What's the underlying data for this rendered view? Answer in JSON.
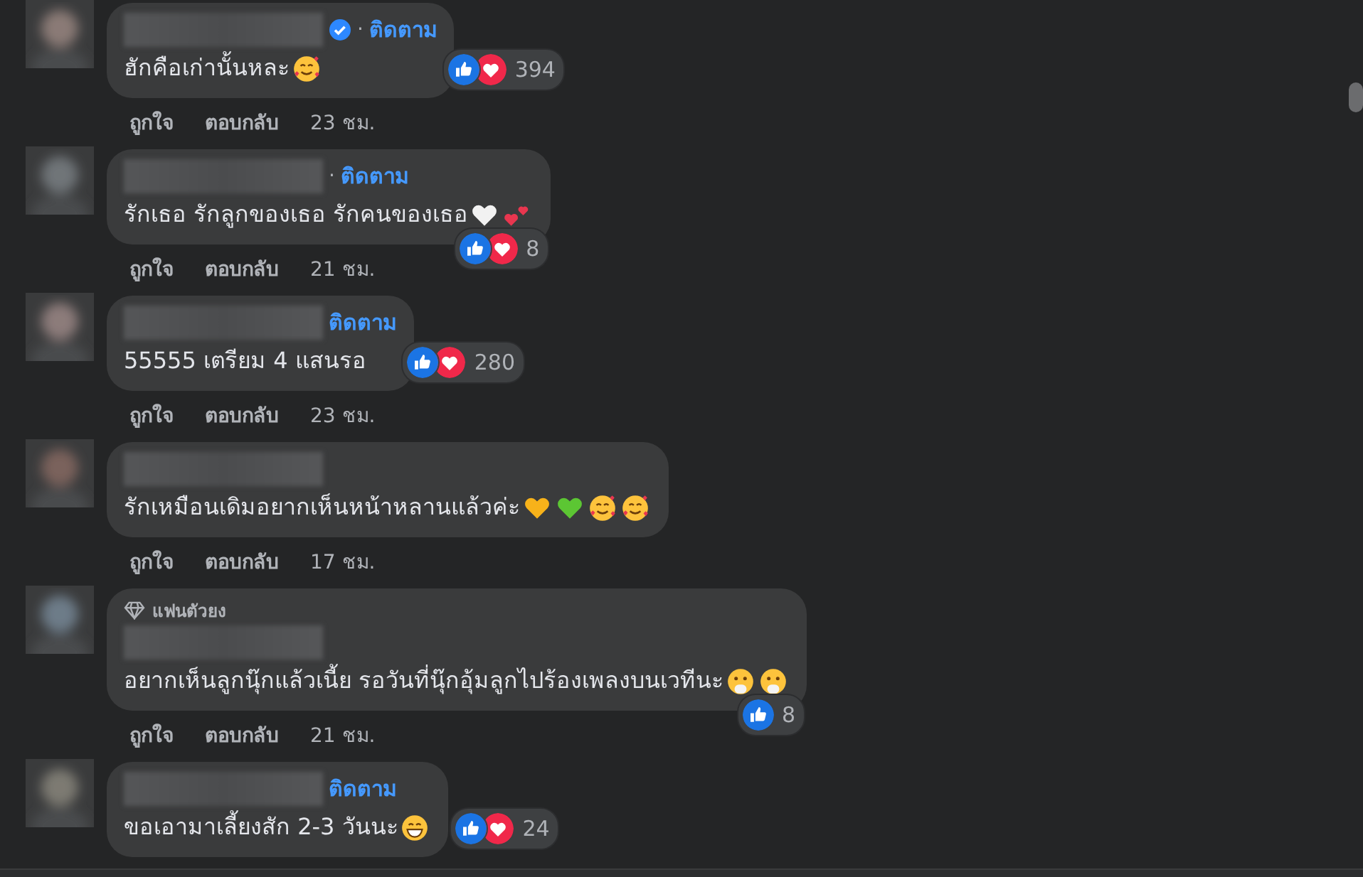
{
  "comments": [
    {
      "verified": true,
      "separator": "·",
      "follow": "ติดตาม",
      "text": "ฮักคือเก่านั้นหละ",
      "emojis": [
        {
          "kind": "smiling-hearts"
        }
      ],
      "reactions": [
        {
          "kind": "like"
        },
        {
          "kind": "love"
        }
      ],
      "reaction_count": "394",
      "actions": {
        "like": "ถูกใจ",
        "reply": "ตอบกลับ",
        "time": "23 ชม."
      }
    },
    {
      "separator": "·",
      "follow": "ติดตาม",
      "text": "รักเธอ รักลูกของเธอ รักคนของเธอ ",
      "emojis": [
        {
          "kind": "white-heart"
        },
        {
          "kind": "two-hearts"
        }
      ],
      "reactions": [
        {
          "kind": "like"
        },
        {
          "kind": "love"
        }
      ],
      "reaction_count": "8",
      "actions": {
        "like": "ถูกใจ",
        "reply": "ตอบกลับ",
        "time": "21 ชม."
      }
    },
    {
      "follow": "ติดตาม",
      "text": "55555 เตรียม 4 แสนรอ",
      "reactions": [
        {
          "kind": "like"
        },
        {
          "kind": "love"
        }
      ],
      "reaction_count": "280",
      "actions": {
        "like": "ถูกใจ",
        "reply": "ตอบกลับ",
        "time": "23 ชม."
      }
    },
    {
      "text": "รักเหมือนเดิมอยากเห็นหน้าหลานแล้วค่ะ",
      "emojis": [
        {
          "kind": "yellow-heart"
        },
        {
          "kind": "green-heart"
        },
        {
          "kind": "smiling-hearts"
        },
        {
          "kind": "smiling-hearts"
        }
      ],
      "actions": {
        "like": "ถูกใจ",
        "reply": "ตอบกลับ",
        "time": "17 ชม."
      }
    },
    {
      "badge": "แฟนตัวยง",
      "text": "อยากเห็นลูกนุ๊กแล้วเนี้ย รอวันที่นุ๊กอุ้มลูกไปร้องเพลงบนเวทีนะ ",
      "emojis": [
        {
          "kind": "hand-over-mouth"
        },
        {
          "kind": "hand-over-mouth"
        }
      ],
      "reactions": [
        {
          "kind": "like"
        }
      ],
      "reaction_count": "8",
      "actions": {
        "like": "ถูกใจ",
        "reply": "ตอบกลับ",
        "time": "21 ชม."
      }
    },
    {
      "follow": "ติดตาม",
      "text": "ขอเอามาเลี้ยงสัก 2-3 วันนะ",
      "emojis": [
        {
          "kind": "grinning"
        }
      ],
      "reactions": [
        {
          "kind": "like"
        },
        {
          "kind": "love"
        }
      ],
      "reaction_count": "24"
    }
  ]
}
